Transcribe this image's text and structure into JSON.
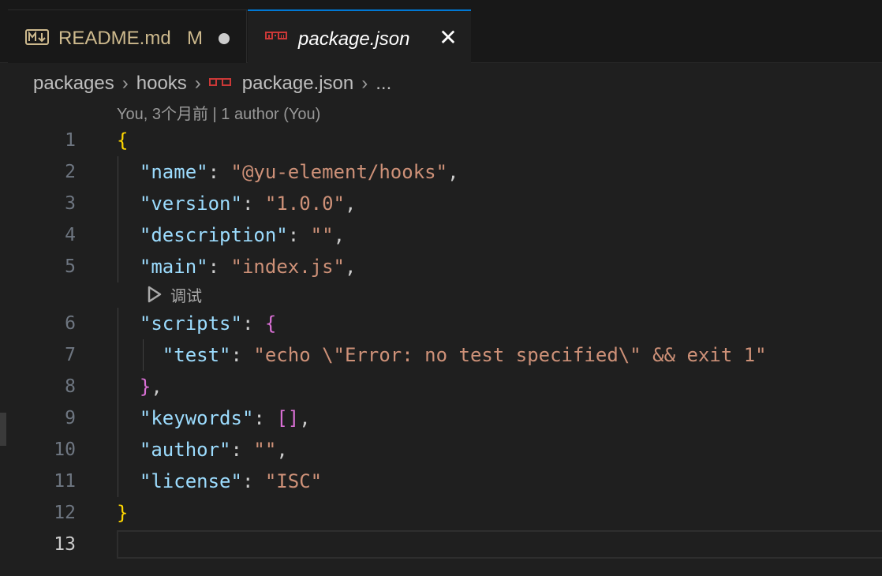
{
  "tabs": [
    {
      "icon": "markdown-icon",
      "label": "README.md",
      "badge": "M",
      "dirty": true
    },
    {
      "icon": "npm-icon",
      "label": "package.json",
      "close": "✕"
    }
  ],
  "breadcrumb": {
    "items": [
      "packages",
      "hooks",
      "package.json",
      "..."
    ],
    "separator": "›"
  },
  "codelens": {
    "blame": "You, 3个月前 | 1 author (You)",
    "debug": "调试"
  },
  "editor": {
    "line_numbers": [
      "1",
      "2",
      "3",
      "4",
      "5",
      "6",
      "7",
      "8",
      "9",
      "10",
      "11",
      "12",
      "13"
    ],
    "current_line": "13",
    "lines": {
      "l1_open": "{",
      "name_key": "\"name\"",
      "name_val": "\"@yu-element/hooks\"",
      "version_key": "\"version\"",
      "version_val": "\"1.0.0\"",
      "description_key": "\"description\"",
      "description_val": "\"\"",
      "main_key": "\"main\"",
      "main_val": "\"index.js\"",
      "scripts_key": "\"scripts\"",
      "scripts_open": "{",
      "test_key": "\"test\"",
      "test_val": "\"echo \\\"Error: no test specified\\\" && exit 1\"",
      "scripts_close": "}",
      "keywords_key": "\"keywords\"",
      "keywords_val": "[]",
      "author_key": "\"author\"",
      "author_val": "\"\"",
      "license_key": "\"license\"",
      "license_val": "\"ISC\"",
      "l12_close": "}"
    }
  },
  "colors": {
    "background": "#1f1f1f",
    "tab_active_border": "#0078d4",
    "key": "#9cdcfe",
    "string": "#ce9178",
    "bracket_gold": "#ffd700",
    "bracket_purple": "#da70d6"
  }
}
